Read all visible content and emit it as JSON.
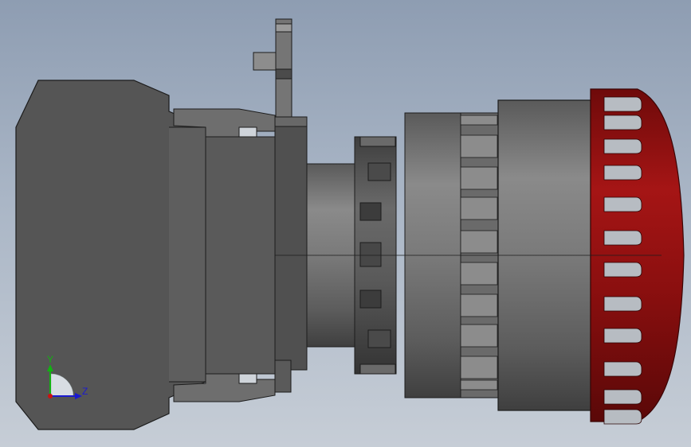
{
  "viewport": {
    "model": "emergency-stop-push-button",
    "view": "side",
    "background_top": "#8e9db2",
    "background_bottom": "#c6cdd6"
  },
  "colors": {
    "body_dark": "#555555",
    "body_mid": "#6c6c6c",
    "metal_light": "#8a8a8a",
    "edge": "#1c1c1c",
    "mushroom_red": "#8b0f0f",
    "mushroom_red_dark": "#5a0808",
    "axis_y": "#12b112",
    "axis_z": "#1a1ad0",
    "axis_origin": "#cc1111"
  },
  "triad": {
    "y_label": "Y",
    "z_label": "Z",
    "icons": [
      "y-axis-arrow-icon",
      "z-axis-arrow-icon",
      "origin-dot-icon"
    ]
  }
}
